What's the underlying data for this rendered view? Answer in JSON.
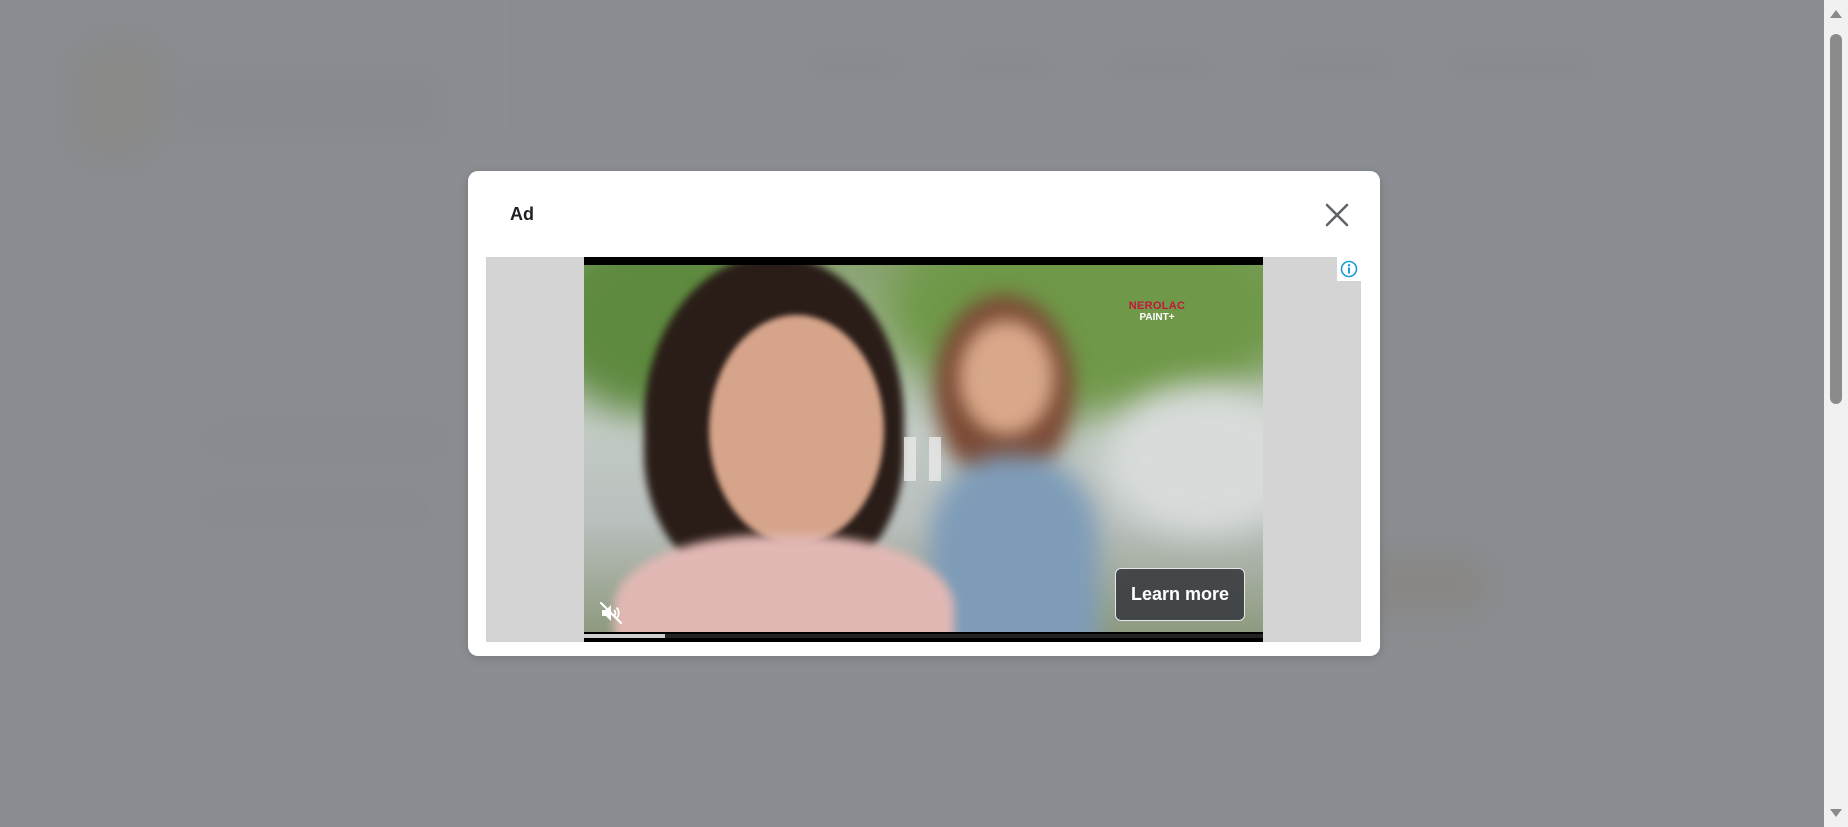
{
  "modal": {
    "title": "Ad",
    "close_icon": "close-icon"
  },
  "ad": {
    "info_icon": "info-icon",
    "brand_line1": "NEROLAC",
    "brand_line2": "PAINT+",
    "learn_more_label": "Learn more",
    "pause_icon": "pause-icon",
    "mute_icon": "muted-speaker-icon",
    "progress_fraction": 0.12
  },
  "colors": {
    "overlay": "#808388",
    "info": "#1a9ed4",
    "learn_more_bg": "#3c3e42",
    "brand_red": "#c2183a"
  }
}
